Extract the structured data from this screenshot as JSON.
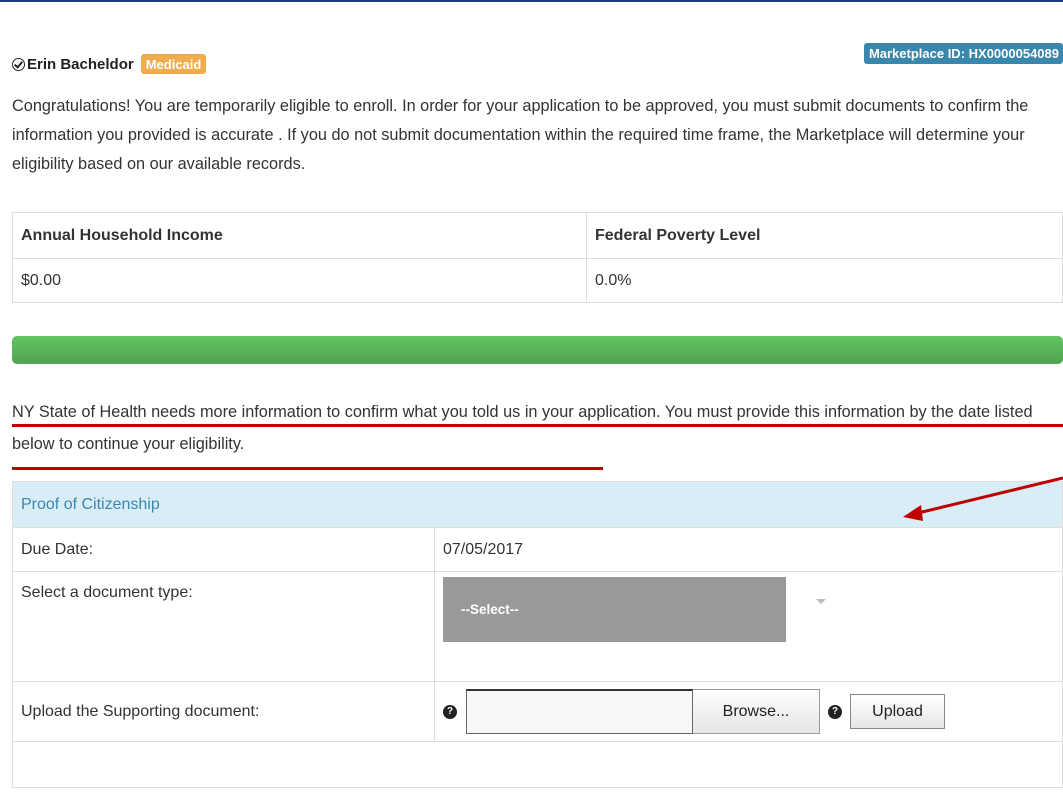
{
  "applicant": {
    "name": "Erin Bacheldor",
    "program_badge": "Medicaid",
    "marketplace_id": "Marketplace ID: HX0000054089"
  },
  "intro_text": "Congratulations! You are temporarily eligible to enroll. In order for your application to be approved, you must submit documents to confirm the information you provided is accurate . If you do not submit documentation within the required time frame, the Marketplace will determine your eligibility based on our available records.",
  "income_table": {
    "headers": [
      "Annual Household Income",
      "Federal Poverty Level"
    ],
    "row": [
      "$0.00",
      "0.0%"
    ]
  },
  "progress": {
    "fraction": 1.0,
    "color": "#5cb85c"
  },
  "notice_text": "NY State of Health needs more information to confirm what you told us in your application. You must provide this information by the date listed below to continue your eligibility.",
  "document_panel": {
    "title": "Proof of Citizenship",
    "due_date_label": "Due Date:",
    "due_date_value": "07/05/2017",
    "doc_type_label": "Select a document type:",
    "doc_type_selected": "--Select--",
    "upload_label": "Upload the Supporting document:",
    "browse_label": "Browse...",
    "upload_button_label": "Upload",
    "help_icon_glyph": "?"
  },
  "colors": {
    "header_rule": "#1f3e80",
    "badge_medicaid": "#f0ad4e",
    "badge_marketplace": "#3a87ad",
    "annotation_red": "#c00000",
    "panel_header_bg": "#d9edf7"
  }
}
